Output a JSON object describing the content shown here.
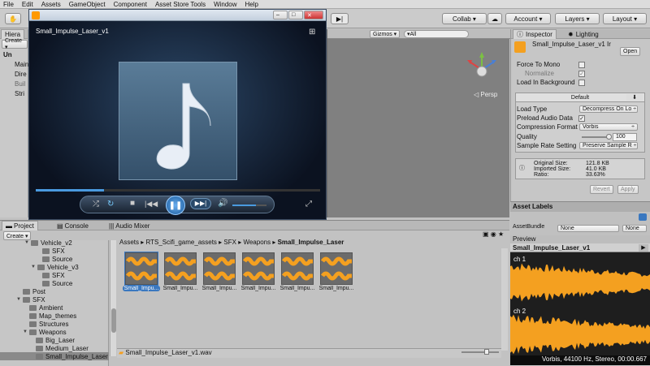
{
  "menu": [
    "File",
    "Edit",
    "Assets",
    "GameObject",
    "Component",
    "Asset Store Tools",
    "Window",
    "Help"
  ],
  "toolbar": {
    "collab": "Collab ▾",
    "account": "Account ▾",
    "layers": "Layers ▾",
    "layout": "Layout ▾"
  },
  "hierarchy": {
    "tab": "Hiera",
    "create": "Create ▾",
    "items": [
      "Un",
      "Main",
      "Dire",
      "Buil",
      "Stri"
    ]
  },
  "scene": {
    "gizmos": "Gizmos ▾",
    "search": "▾All",
    "persp": "◁ Persp"
  },
  "player": {
    "title": "Small_Impulse_Laser_v1",
    "progress": 0.24,
    "volume": 0.7
  },
  "inspector": {
    "tab": "Inspector",
    "lighting": "Lighting",
    "asset_name": "Small_Impulse_Laser_v1 Ir",
    "open": "Open",
    "force_mono": "Force To Mono",
    "normalize": "Normalize",
    "load_bg": "Load In Background",
    "default_tab": "Default",
    "load_type_label": "Load Type",
    "load_type": "Decompress On Lo ÷",
    "preload": "Preload Audio Data",
    "compression_label": "Compression Format",
    "compression": "Vorbis",
    "quality_label": "Quality",
    "quality": "100",
    "sample_label": "Sample Rate Setting",
    "sample": "Preserve Sample R ÷",
    "orig_label": "Original Size:",
    "orig": "121.8 KB",
    "imp_label": "Imported Size:",
    "imp": "41.0 KB",
    "ratio_label": "Ratio:",
    "ratio": "33.63%",
    "revert": "Revert",
    "apply": "Apply",
    "asset_labels": "Asset Labels",
    "asset_bundle": "AssetBundle",
    "none1": "None",
    "none2": "None"
  },
  "preview": {
    "tab": "Preview",
    "name": "Small_Impulse_Laser_v1",
    "ch1": "ch 1",
    "ch2": "ch 2",
    "info": "Vorbis, 44100 Hz, Stereo, 00:00.667"
  },
  "project": {
    "tab": "Project",
    "console": "Console",
    "mixer": "Audio Mixer",
    "create": "Create ▾",
    "tree": [
      "Vehicle_v2",
      "SFX",
      "Source",
      "Vehicle_v3",
      "SFX",
      "Source",
      "Post",
      "SFX",
      "Ambient",
      "Map_themes",
      "Structures",
      "Weapons",
      "Big_Laser",
      "Medium_Laser",
      "Small_Impulse_Laser"
    ],
    "breadcrumb": [
      "Assets",
      "RTS_Scifi_game_assets",
      "SFX",
      "Weapons",
      "Small_Impulse_Laser"
    ],
    "thumbs": [
      "Small_Impu...",
      "Small_Impu...",
      "Small_Impu...",
      "Small_Impu...",
      "Small_Impu...",
      "Small_Impu..."
    ],
    "footer": "Small_Impulse_Laser_v1.wav"
  }
}
